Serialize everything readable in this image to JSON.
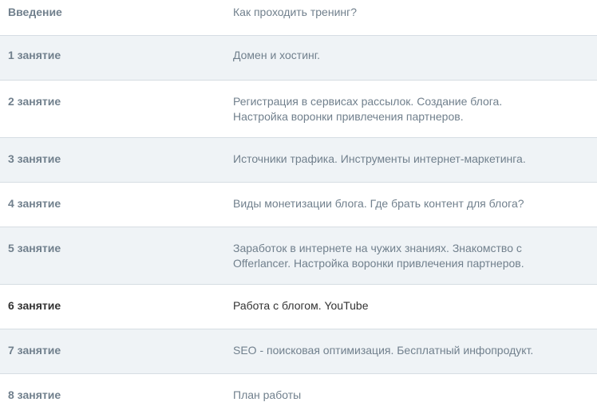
{
  "schedule": {
    "rows": [
      {
        "lesson": "Введение",
        "topic": "Как проходить тренинг?"
      },
      {
        "lesson": "1 занятие",
        "topic": "Домен и хостинг."
      },
      {
        "lesson": "2 занятие",
        "topic": "Регистрация в сервисах рассылок. Создание блога.\nНастройка воронки привлечения партнеров."
      },
      {
        "lesson": "3 занятие",
        "topic": "Источники трафика. Инструменты интернет-маркетинга."
      },
      {
        "lesson": "4 занятие",
        "topic": "Виды монетизации блога. Где брать контент для блога?"
      },
      {
        "lesson": "5 занятие",
        "topic": "Заработок в интернете на чужих знаниях. Знакомство с\nOfferlancer. Настройка воронки привлечения партнеров."
      },
      {
        "lesson": "6 занятие",
        "topic": "Работа с блогом. YouTube"
      },
      {
        "lesson": "7 занятие",
        "topic": "SEO - поисковая оптимизация. Бесплатный инфопродукт."
      },
      {
        "lesson": "8 занятие",
        "topic": "План работы"
      }
    ],
    "colors": {
      "text_muted": "#71808d",
      "text_active": "#333333",
      "row_alt_background": "#eff3f6",
      "divider": "#d6dde3"
    }
  }
}
